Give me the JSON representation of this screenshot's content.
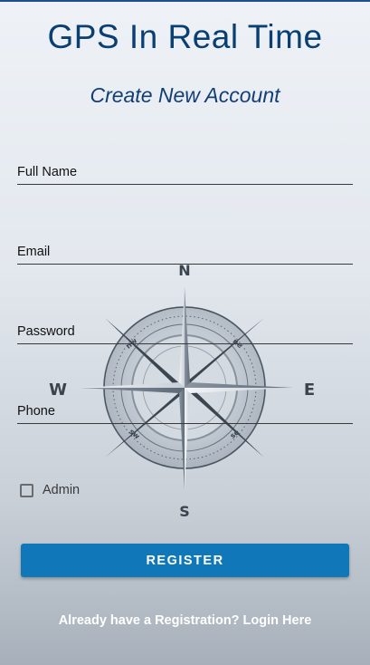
{
  "header": {
    "title": "GPS In Real Time",
    "subtitle": "Create New Account"
  },
  "form": {
    "full_name_label": "Full Name",
    "email_label": "Email",
    "password_label": "Password",
    "phone_label": "Phone",
    "full_name_value": "",
    "email_value": "",
    "password_value": "",
    "phone_value": "",
    "admin_label": "Admin",
    "admin_checked": false,
    "register_label": "REGISTER",
    "login_link": "Already have a Registration? Login Here"
  },
  "background": {
    "icon": "compass-icon",
    "letters": {
      "n": "N",
      "s": "S",
      "e": "E",
      "w": "W",
      "nw": "nw",
      "ne": "ne",
      "sw": "sw",
      "se": "se"
    }
  },
  "colors": {
    "title": "#0a3f72",
    "button": "#1078b8",
    "button_text": "#ffffff"
  }
}
